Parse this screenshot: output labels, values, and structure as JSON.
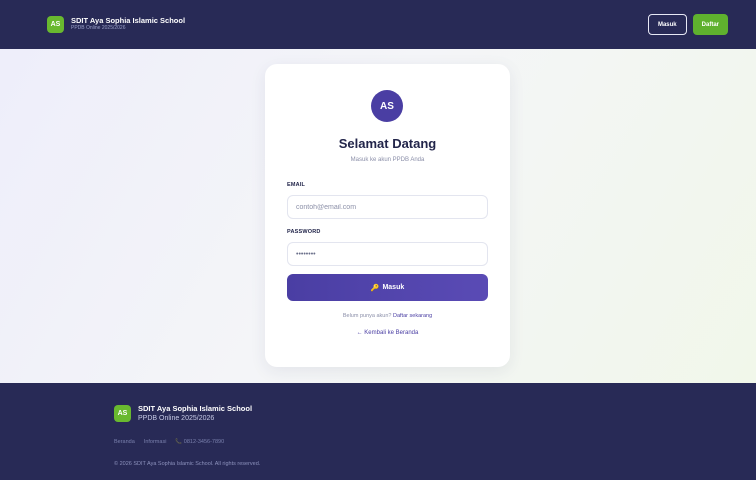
{
  "header": {
    "logo": "AS",
    "title": "SDIT Aya Sophia Islamic School",
    "subtitle": "PPDB Online 2025/2026",
    "login_label": "Masuk",
    "register_label": "Daftar"
  },
  "login": {
    "avatar": "AS",
    "title": "Selamat Datang",
    "subtitle": "Masuk ke akun PPDB Anda",
    "email_label": "EMAIL",
    "email_placeholder": "contoh@email.com",
    "password_label": "PASSWORD",
    "password_value": "password",
    "submit_icon": "key-icon",
    "submit_label": "Masuk",
    "register_prompt": "Belum punya akun?",
    "register_link": "Daftar sekarang",
    "back_link": "← Kembali ke Beranda"
  },
  "footer": {
    "logo": "AS",
    "title": "SDIT Aya Sophia Islamic School",
    "subtitle": "PPDB Online 2025/2026",
    "links": [
      "Beranda",
      "Informasi",
      "📞 0812-3456-7890"
    ],
    "copyright": "© 2026 SDIT Aya Sophia Islamic School. All rights reserved."
  },
  "colors": {
    "primary": "#4a3ea3",
    "navy": "#282a56",
    "green": "#5fb12e"
  }
}
